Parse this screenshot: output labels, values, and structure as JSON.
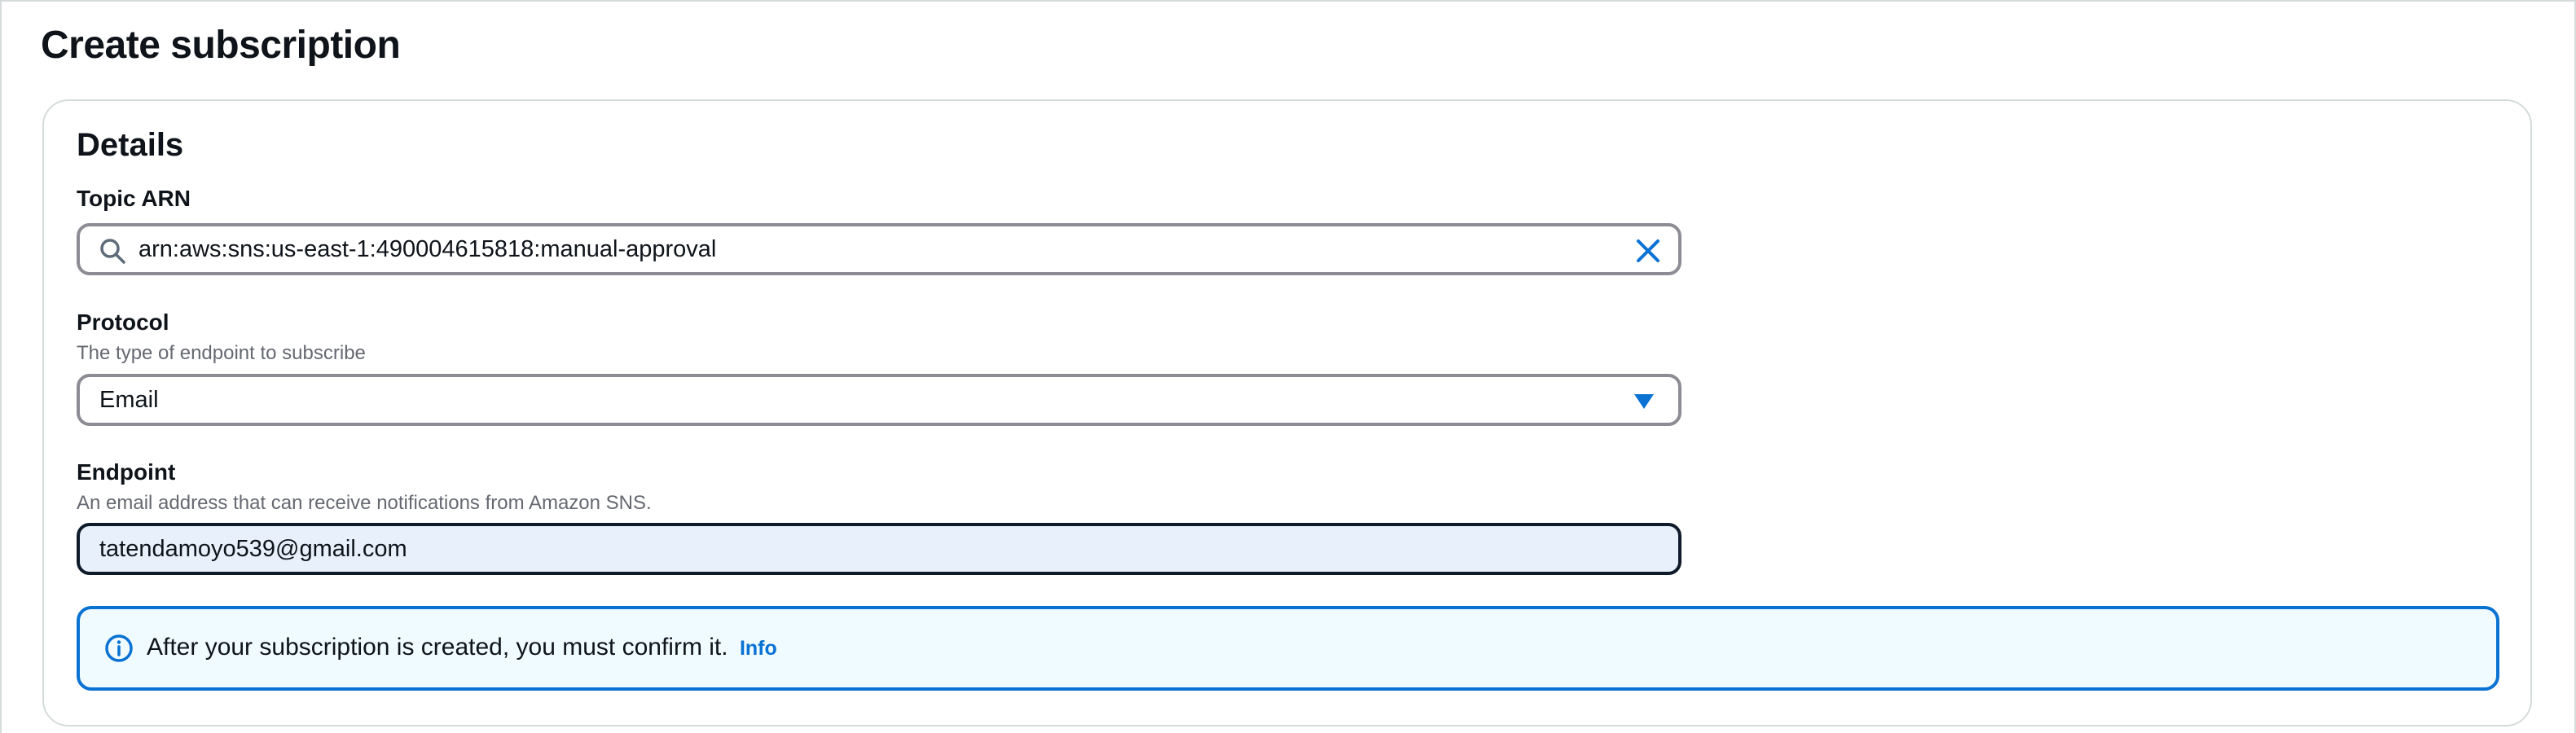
{
  "page": {
    "title": "Create subscription"
  },
  "details": {
    "title": "Details",
    "topic_arn": {
      "label": "Topic ARN",
      "value": "arn:aws:sns:us-east-1:490004615818:manual-approval",
      "search_icon": "search-icon",
      "clear_icon": "close-icon"
    },
    "protocol": {
      "label": "Protocol",
      "description": "The type of endpoint to subscribe",
      "selected": "Email",
      "caret_icon": "caret-down-icon"
    },
    "endpoint": {
      "label": "Endpoint",
      "description": "An email address that can receive notifications from Amazon SNS.",
      "value": "tatendamoyo539@gmail.com"
    },
    "alert": {
      "text": "After your subscription is created, you must confirm it.",
      "link": "Info",
      "icon": "info-icon"
    }
  },
  "colors": {
    "accent": "#0972d3",
    "text": "#0f141a",
    "muted": "#656871",
    "field_border": "#8c8c94",
    "alert_bg": "#f0fbff",
    "focused_bg": "#e8f1fb"
  }
}
